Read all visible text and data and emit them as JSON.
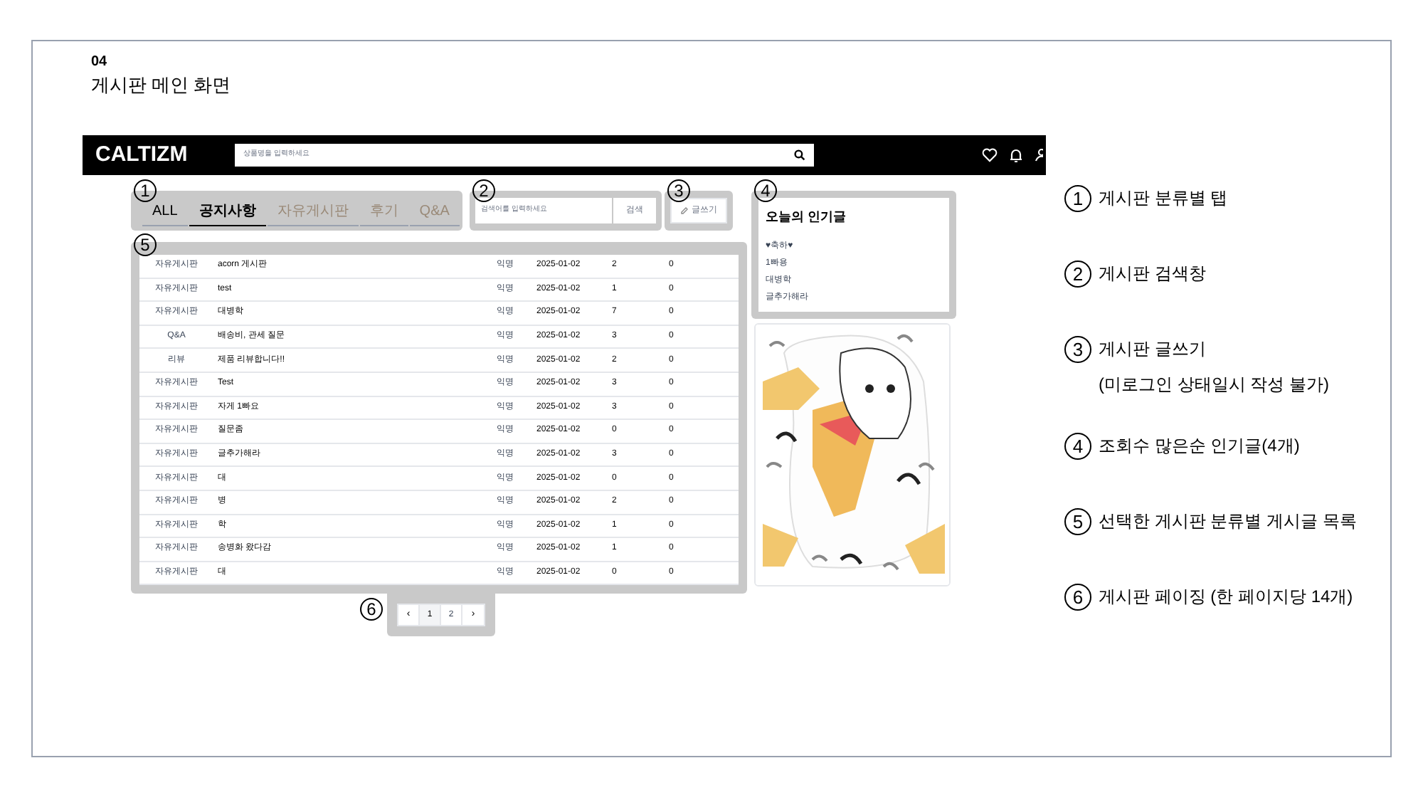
{
  "slide": {
    "number": "04",
    "title": "게시판 메인 화면"
  },
  "header": {
    "logo": "CALTIZM",
    "search": {
      "placeholder": "상품명을 입력하세요"
    }
  },
  "markers": [
    "1",
    "2",
    "3",
    "4",
    "5",
    "6"
  ],
  "tabs": [
    {
      "label": "ALL",
      "selected": false,
      "dimmed": false
    },
    {
      "label": "공지사항",
      "selected": true,
      "dimmed": false
    },
    {
      "label": "자유게시판",
      "selected": false,
      "dimmed": true
    },
    {
      "label": "후기",
      "selected": false,
      "dimmed": true
    },
    {
      "label": "Q&A",
      "selected": false,
      "dimmed": true
    }
  ],
  "board_search": {
    "placeholder": "검색어를 입력하세요",
    "button": "검색"
  },
  "write_button": "글쓰기",
  "posts": [
    {
      "category": "자유게시판",
      "title": "acorn 게시판",
      "author": "익명",
      "date": "2025-01-02",
      "views": "2",
      "comments": "0"
    },
    {
      "category": "자유게시판",
      "title": "test",
      "author": "익명",
      "date": "2025-01-02",
      "views": "1",
      "comments": "0"
    },
    {
      "category": "자유게시판",
      "title": "대병학",
      "author": "익명",
      "date": "2025-01-02",
      "views": "7",
      "comments": "0"
    },
    {
      "category": "Q&A",
      "title": "배송비, 관세 질문",
      "author": "익명",
      "date": "2025-01-02",
      "views": "3",
      "comments": "0"
    },
    {
      "category": "리뷰",
      "title": "제품 리뷰합니다!!",
      "author": "익명",
      "date": "2025-01-02",
      "views": "2",
      "comments": "0"
    },
    {
      "category": "자유게시판",
      "title": "Test",
      "author": "익명",
      "date": "2025-01-02",
      "views": "3",
      "comments": "0"
    },
    {
      "category": "자유게시판",
      "title": "자게 1빠요",
      "author": "익명",
      "date": "2025-01-02",
      "views": "3",
      "comments": "0"
    },
    {
      "category": "자유게시판",
      "title": "질문좀",
      "author": "익명",
      "date": "2025-01-02",
      "views": "0",
      "comments": "0"
    },
    {
      "category": "자유게시판",
      "title": "글추가해라",
      "author": "익명",
      "date": "2025-01-02",
      "views": "3",
      "comments": "0"
    },
    {
      "category": "자유게시판",
      "title": "대",
      "author": "익명",
      "date": "2025-01-02",
      "views": "0",
      "comments": "0"
    },
    {
      "category": "자유게시판",
      "title": "병",
      "author": "익명",
      "date": "2025-01-02",
      "views": "2",
      "comments": "0"
    },
    {
      "category": "자유게시판",
      "title": "학",
      "author": "익명",
      "date": "2025-01-02",
      "views": "1",
      "comments": "0"
    },
    {
      "category": "자유게시판",
      "title": "송병화 왔다감",
      "author": "익명",
      "date": "2025-01-02",
      "views": "1",
      "comments": "0"
    },
    {
      "category": "자유게시판",
      "title": "대",
      "author": "익명",
      "date": "2025-01-02",
      "views": "0",
      "comments": "0"
    }
  ],
  "pagination": {
    "prev": "‹",
    "pages": [
      {
        "label": "1",
        "selected": true
      },
      {
        "label": "2",
        "selected": false
      }
    ],
    "next": "›"
  },
  "popular": {
    "title": "오늘의 인기글",
    "items": [
      "♥축하♥",
      "1빠용",
      "대병학",
      "글추가해라"
    ]
  },
  "legend": [
    {
      "number": "1",
      "lines": [
        "게시판 분류별 탭"
      ]
    },
    {
      "number": "2",
      "lines": [
        "게시판 검색창"
      ]
    },
    {
      "number": "3",
      "lines": [
        "게시판 글쓰기",
        "(미로그인 상태일시 작성 불가)"
      ]
    },
    {
      "number": "4",
      "lines": [
        "조회수 많은순 인기글(4개)"
      ]
    },
    {
      "number": "5",
      "lines": [
        "선택한 게시판 분류별 게시글 목록"
      ]
    },
    {
      "number": "6",
      "lines": [
        "게시판 페이징 (한 페이지당 14개)"
      ]
    }
  ]
}
